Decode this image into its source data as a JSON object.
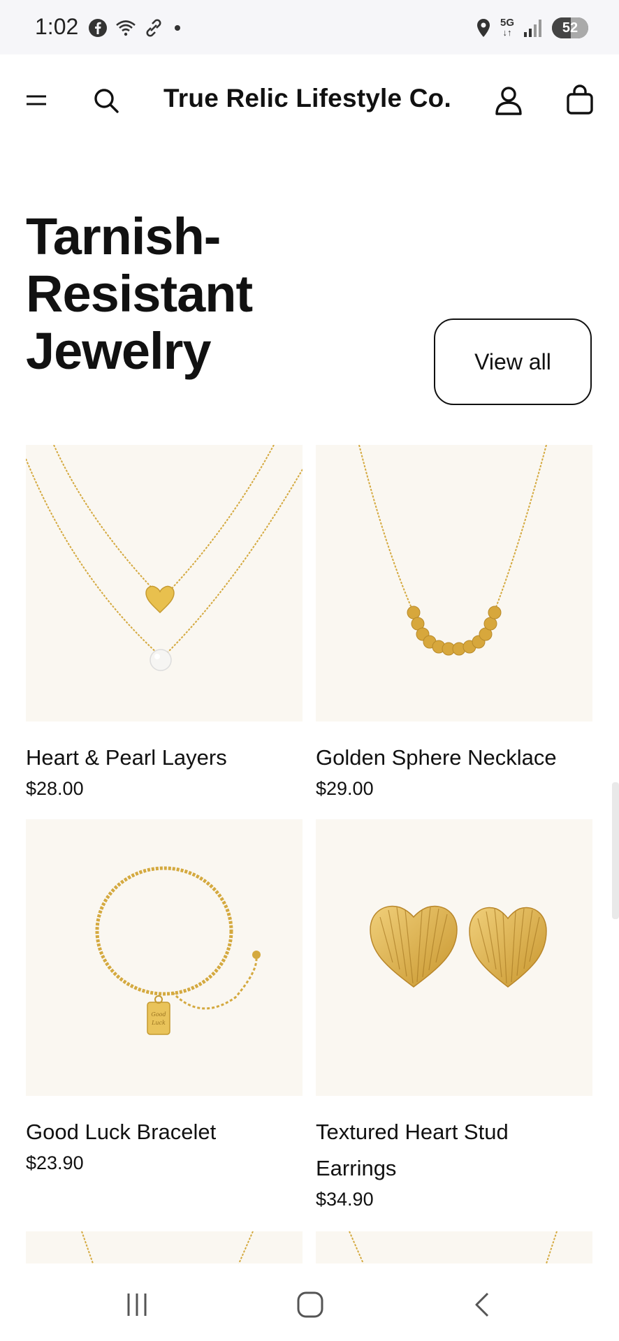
{
  "status_bar": {
    "time": "1:02",
    "left_icons": [
      "facebook-icon",
      "wifi-question-icon",
      "link-icon",
      "dot-icon"
    ],
    "right_icons": [
      "location-icon",
      "5g-icon",
      "signal-icon"
    ],
    "network": "5G",
    "battery": "52",
    "battery_level": 0.52
  },
  "header": {
    "brand": "True Relic Lifestyle Co.",
    "icons": [
      "menu-icon",
      "search-icon",
      "account-icon",
      "bag-icon"
    ]
  },
  "section": {
    "title": "Tarnish-Resistant Jewelry",
    "view_all_label": "View all"
  },
  "products": [
    {
      "name": "Heart & Pearl Layers",
      "price": "$28.00"
    },
    {
      "name": "Golden Sphere Necklace",
      "price": "$29.00"
    },
    {
      "name": "Good Luck Bracelet",
      "price": "$23.90"
    },
    {
      "name": "Textured Heart Stud Earrings",
      "price": "$34.90"
    }
  ],
  "colors": {
    "product_bg": "#faf7f1",
    "gold": "#d4a93f",
    "text": "#111111"
  },
  "nav_bar": {
    "icons": [
      "recents-icon",
      "home-icon",
      "back-icon"
    ]
  }
}
